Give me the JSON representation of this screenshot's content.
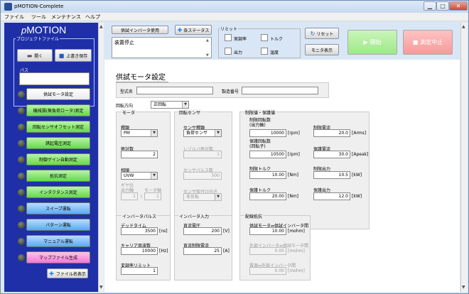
{
  "window": {
    "title": "pMOTION-Complete",
    "min_glyph": "▁",
    "max_glyph": "□",
    "close_glyph": "✕"
  },
  "menu": [
    "ファイル",
    "ツール",
    "メンテナンス",
    "ヘルプ"
  ],
  "sidebar": {
    "logo_p": "p",
    "logo_rest": "MOTION",
    "project_file_label": "プロジェクトファイル",
    "open_label": "開く",
    "overwrite_label": "上書き保存",
    "path_label": "パス",
    "path_value": "",
    "nav": [
      {
        "label": "供試モータ設定",
        "style": "white"
      },
      {
        "label": "機械損(無負荷ロータ)測定",
        "style": "green"
      },
      {
        "label": "回転センサオフセット測定",
        "style": "green"
      },
      {
        "label": "誘起電圧測定",
        "style": "green"
      },
      {
        "label": "制御ゲイン自動測定",
        "style": "green"
      },
      {
        "label": "抵抗測定",
        "style": "green"
      },
      {
        "label": "インダクタンス測定",
        "style": "green"
      },
      {
        "label": "スイープ運転",
        "style": "blue"
      },
      {
        "label": "パターン運転",
        "style": "blue"
      },
      {
        "label": "マニュアル運転",
        "style": "blue"
      },
      {
        "label": "マップファイル生成",
        "style": "pink"
      }
    ],
    "file_display_label": "ファイル名表示"
  },
  "topbar": {
    "inverter_label": "供試インバータ使用",
    "status_button": "各ステータス",
    "status_text": "装置停止",
    "reset_group": "リミット",
    "limits": [
      "実調率",
      "トルク",
      "出力",
      "温度"
    ],
    "reset_button": "リセット",
    "monitor_button": "モニタ表示",
    "start_button": "開始",
    "stop_button": "測定中止"
  },
  "settings": {
    "title": "供試モータ設定",
    "model_label": "型式名",
    "model_value": "",
    "serial_label": "製造番号",
    "serial_value": "",
    "rotation_label": "回転方向",
    "rotation_value": "正回転",
    "motor": {
      "title": "モータ",
      "type_label": "種類",
      "type_value": "PM",
      "poles_label": "極対数",
      "poles_value": "2",
      "phase_label": "相順",
      "phase_value": "UVW",
      "gear_label": "ギヤ比",
      "gear_out_label": "出力軸",
      "gear_motor_label": "モータ軸",
      "gear_out_value": "1",
      "gear_motor_value": "1",
      "gear_sep": ":"
    },
    "sensor": {
      "title": "回転センサ",
      "type_label": "センサ種類",
      "type_value": "負荷センサ",
      "resolver_label": "レゾルバ極対数",
      "resolver_value": "1",
      "pulse_label": "センサパルス数",
      "pulse_value": "500",
      "direction_label": "センサ取付け向き",
      "direction_value": "非反転"
    },
    "limits": {
      "title": "制限値・保護値",
      "items": [
        {
          "label": "制限回転数\n(出力軸)",
          "value": "10000",
          "unit": "[rpm]"
        },
        {
          "label": "制限電流",
          "value": "20.0",
          "unit": "[Arms]"
        },
        {
          "label": "保護回転数\n(回転子)",
          "value": "10500",
          "unit": "[rpm]"
        },
        {
          "label": "保護電流",
          "value": "30.0",
          "unit": "[Apeak]"
        },
        {
          "label": "制限トルク",
          "value": "10.00",
          "unit": "[Nm]"
        },
        {
          "label": "制限出力",
          "value": "10.5",
          "unit": "[kW]"
        },
        {
          "label": "保護トルク",
          "value": "20.00",
          "unit": "[Nm]"
        },
        {
          "label": "保護出力",
          "value": "12.0",
          "unit": "[kW]"
        }
      ]
    },
    "inverter_pulse": {
      "title": "インバータパルス",
      "deadtime_label": "デッドタイム",
      "deadtime_value": "3500",
      "deadtime_unit": "[ns]",
      "carrier_label": "キャリア周波数",
      "carrier_value": "10000",
      "carrier_unit": "[Hz]",
      "modulation_label": "変調率リミット",
      "modulation_value": "1"
    },
    "inverter_input": {
      "title": "インバータ入力",
      "dc_voltage_label": "直流電圧",
      "dc_voltage_value": "200",
      "dc_voltage_unit": "[V]",
      "dc_current_label": "直流制限電流",
      "dc_current_value": "25",
      "dc_current_unit": "[A]"
    },
    "wiring": {
      "title": "配線抵抗",
      "motor_inv_label": "供試モータ⇔供試インバータ間",
      "motor_inv_value": "10.00",
      "motor_inv_unit": "[mohm]",
      "ext_inv_label": "外部インバータ⇔供試モータ間",
      "ext_inv_value": "0.00",
      "ext_inv_unit": "[mohm]",
      "psu_label": "電源⇔外部インバータ間",
      "psu_value": "0.00",
      "psu_unit": "[mohm]"
    }
  }
}
